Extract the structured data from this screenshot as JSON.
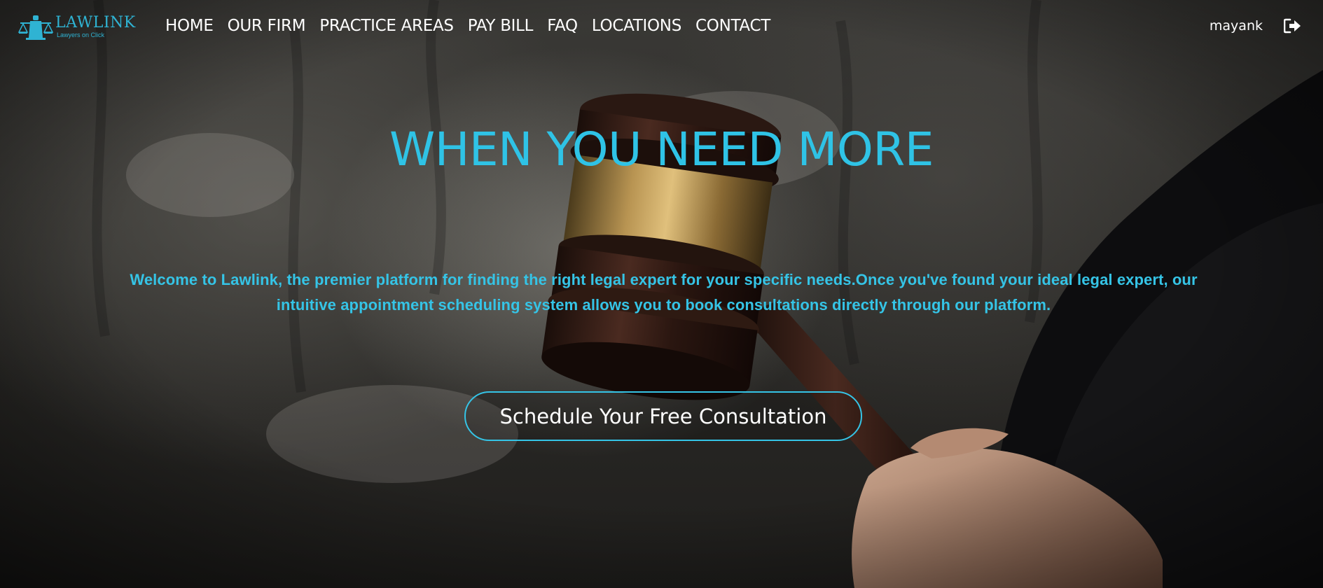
{
  "brand": {
    "name": "LAWLINK",
    "tagline": "Lawyers on Click",
    "color": "#2fb3d3"
  },
  "nav": {
    "items": [
      {
        "label": "HOME"
      },
      {
        "label": "OUR FIRM"
      },
      {
        "label": "PRACTICE AREAS"
      },
      {
        "label": "PAY BILL"
      },
      {
        "label": "FAQ"
      },
      {
        "label": "LOCATIONS"
      },
      {
        "label": "CONTACT"
      }
    ]
  },
  "user": {
    "name": "mayank",
    "logout_icon": "sign-out-icon"
  },
  "hero": {
    "title": "WHEN YOU NEED MORE",
    "description": "Welcome to Lawlink, the premier platform for finding the right legal expert for your specific needs.Once you've found your ideal legal expert, our intuitive appointment scheduling system allows you to book consultations directly through our platform.",
    "cta_label": "Schedule Your Free Consultation",
    "accent_color": "#2fc3e6",
    "background_image": "judge-gavel-photo"
  }
}
